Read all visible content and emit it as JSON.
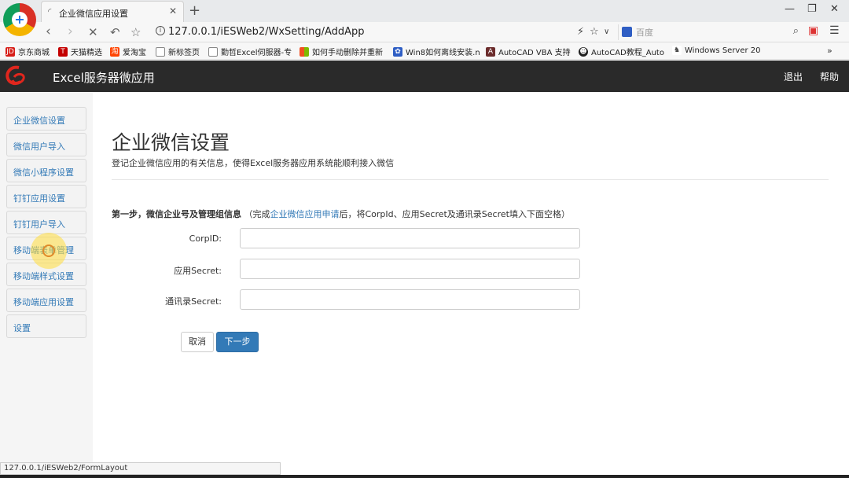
{
  "browser": {
    "tab_title": "企业微信应用设置",
    "url": "127.0.0.1/iESWeb2/WxSetting/AddApp",
    "search_placeholder": "百度",
    "status_url": "127.0.0.1/iESWeb2/FormLayout",
    "bookmarks": [
      {
        "label": "京东商城",
        "icon": "jd-icon",
        "color": "#d71e18"
      },
      {
        "label": "天猫精选",
        "icon": "tmall-icon",
        "color": "#c40000"
      },
      {
        "label": "爱淘宝",
        "icon": "taobao-icon",
        "color": "#ff4400"
      },
      {
        "label": "新标签页",
        "icon": "page-icon",
        "color": "#888888"
      },
      {
        "label": "勤哲Excel伺服器-专",
        "icon": "page-icon",
        "color": "#888888"
      },
      {
        "label": "如何手动删除并重新",
        "icon": "windows-icon",
        "color": "#2f7de1"
      },
      {
        "label": "Win8如何离线安装.n",
        "icon": "baidu-paw-icon",
        "color": "#2f5ec4"
      },
      {
        "label": "AutoCAD VBA 支持",
        "icon": "autocad-icon",
        "color": "#6b2c2c"
      },
      {
        "label": "AutoCAD教程_Auto",
        "icon": "emoji-icon",
        "color": "#222222"
      },
      {
        "label": "Windows Server 20",
        "icon": "wolf-icon",
        "color": "#555555"
      }
    ]
  },
  "app": {
    "title": "Excel服务器微应用",
    "logout": "退出",
    "help": "帮助",
    "accent_color": "#337ab7",
    "header_color": "#2a2a2a"
  },
  "sidebar": {
    "items": [
      {
        "label": "企业微信设置"
      },
      {
        "label": "微信用户导入"
      },
      {
        "label": "微信小程序设置"
      },
      {
        "label": "钉钉应用设置"
      },
      {
        "label": "钉钉用户导入"
      },
      {
        "label": "移动端表单管理"
      },
      {
        "label": "移动端样式设置"
      },
      {
        "label": "移动端应用设置"
      },
      {
        "label": "设置"
      }
    ]
  },
  "main": {
    "title": "企业微信设置",
    "subtitle": "登记企业微信应用的有关信息，使得Excel服务器应用系统能顺利接入微信",
    "step_bold": "第一步，微信企业号及管理组信息",
    "step_note_prefix": "（完成",
    "step_link": "企业微信应用申请",
    "step_note_suffix": "后，将CorpId、应用Secret及通讯录Secret填入下面空格）",
    "fields": [
      {
        "label": "CorpID:",
        "value": ""
      },
      {
        "label": "应用Secret:",
        "value": ""
      },
      {
        "label": "通讯录Secret:",
        "value": ""
      }
    ],
    "cancel_label": "取消",
    "next_label": "下一步"
  }
}
